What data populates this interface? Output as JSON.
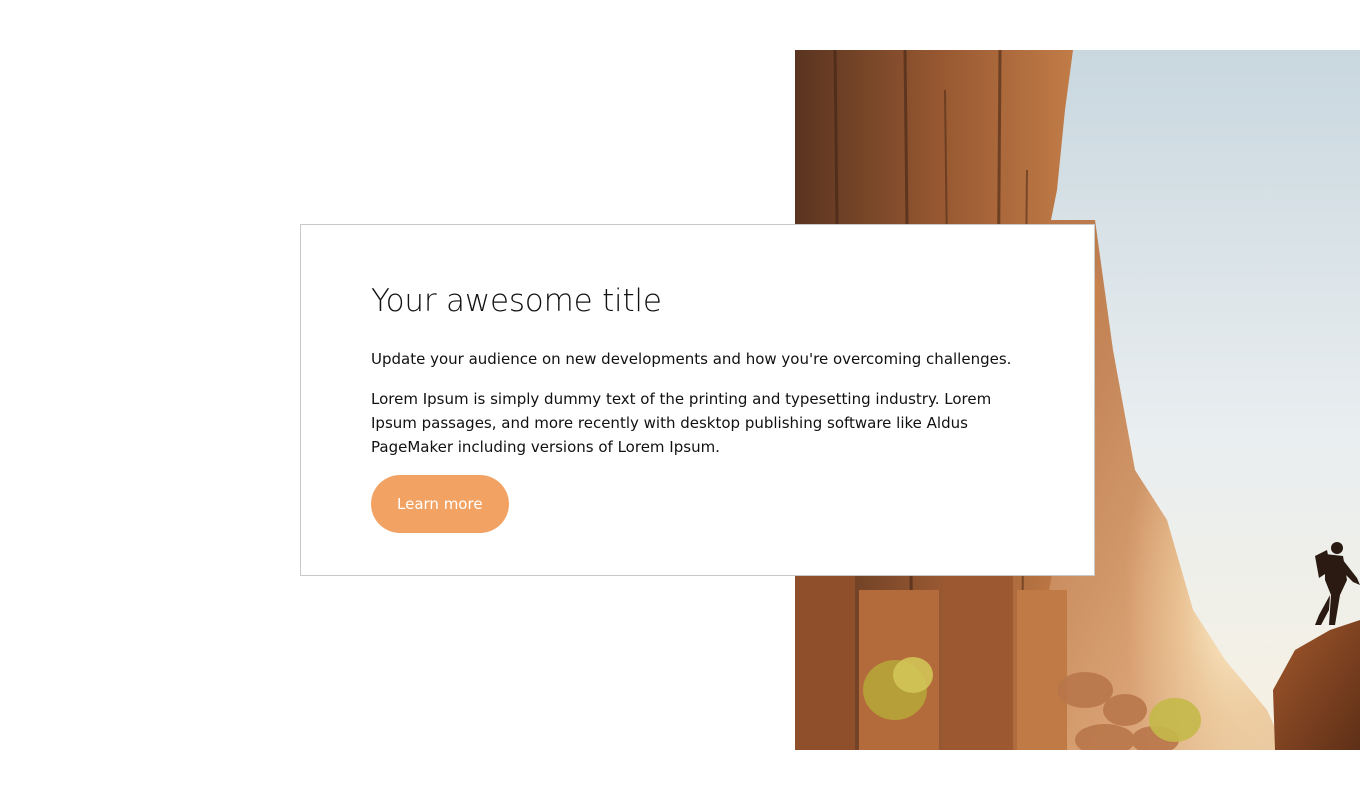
{
  "card": {
    "title": "Your awesome title",
    "subtitle": "Update your audience on new developments and how you're overcoming challenges.",
    "body": "Lorem Ipsum is simply dummy text of the printing and typesetting industry. Lorem Ipsum passages, and more recently with desktop publishing software like Aldus PageMaker including versions of Lorem Ipsum.",
    "button_label": "Learn more"
  },
  "colors": {
    "button_bg": "#f2a263",
    "button_text": "#ffffff",
    "card_border": "#c9c9c9",
    "text": "#111111"
  },
  "image": {
    "subject": "climber-on-sandstone-cliff-image"
  }
}
